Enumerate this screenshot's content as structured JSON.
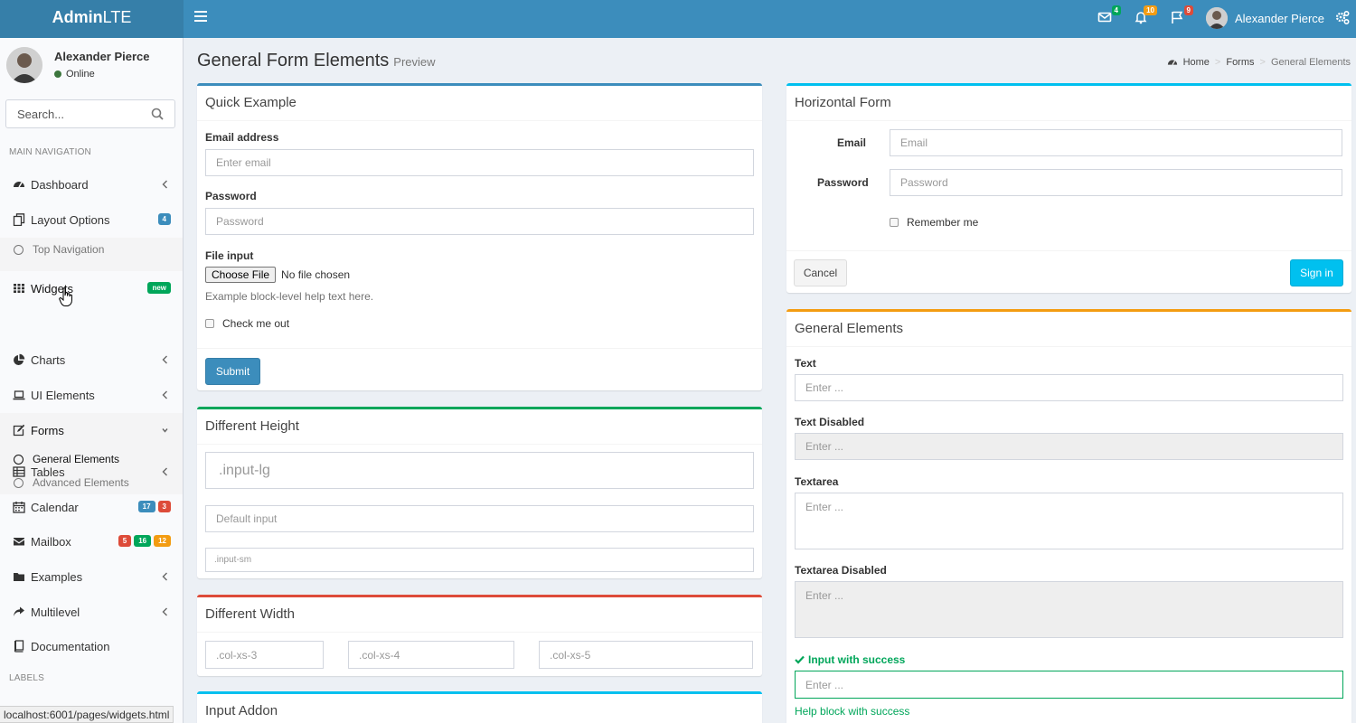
{
  "header": {
    "logo_bold": "Admin",
    "logo_rest": "LTE",
    "messages_count": "4",
    "notifications_count": "10",
    "tasks_count": "9",
    "user_name": "Alexander Pierce",
    "colors": {
      "brand": "#3c8dbc",
      "logo_bg": "#367fa9"
    }
  },
  "sidebar": {
    "user_name": "Alexander Pierce",
    "user_status": "Online",
    "search_placeholder": "Search...",
    "main_nav_header": "MAIN NAVIGATION",
    "labels_header": "LABELS",
    "items": [
      {
        "label": "Dashboard",
        "icon": "dashboard-icon"
      },
      {
        "label": "Layout Options",
        "icon": "files-icon",
        "badge": "4"
      },
      {
        "label": "Widgets",
        "icon": "th-icon",
        "badge": "new"
      },
      {
        "label": "Charts",
        "icon": "pie-chart-icon"
      },
      {
        "label": "UI Elements",
        "icon": "laptop-icon"
      },
      {
        "label": "Forms",
        "icon": "edit-icon"
      },
      {
        "label": "Tables",
        "icon": "table-icon"
      },
      {
        "label": "Calendar",
        "icon": "calendar-icon",
        "badges": [
          "17",
          "3"
        ]
      },
      {
        "label": "Mailbox",
        "icon": "envelope-icon",
        "badges": [
          "5",
          "16",
          "12"
        ]
      },
      {
        "label": "Examples",
        "icon": "folder-icon"
      },
      {
        "label": "Multilevel",
        "icon": "share-icon"
      },
      {
        "label": "Documentation",
        "icon": "book-icon"
      }
    ],
    "layout_sub": [
      "Top Navigation"
    ],
    "forms_sub": [
      "General Elements",
      "Advanced Elements"
    ],
    "status_url": "localhost:6001/pages/widgets.html"
  },
  "content": {
    "title": "General Form Elements",
    "subtitle": "Preview",
    "breadcrumb": [
      "Home",
      "Forms",
      "General Elements"
    ]
  },
  "quick_example": {
    "title": "Quick Example",
    "email_label": "Email address",
    "email_placeholder": "Enter email",
    "password_label": "Password",
    "password_placeholder": "Password",
    "file_label": "File input",
    "file_button": "Choose File",
    "file_status": "No file chosen",
    "help_text": "Example block-level help text here.",
    "check_label": "Check me out",
    "submit": "Submit"
  },
  "different_height": {
    "title": "Different Height",
    "lg_placeholder": ".input-lg",
    "default_placeholder": "Default input",
    "sm_placeholder": ".input-sm"
  },
  "different_width": {
    "title": "Different Width",
    "col3": ".col-xs-3",
    "col4": ".col-xs-4",
    "col5": ".col-xs-5"
  },
  "input_addon": {
    "title": "Input Addon"
  },
  "horizontal_form": {
    "title": "Horizontal Form",
    "email_label": "Email",
    "email_placeholder": "Email",
    "password_label": "Password",
    "password_placeholder": "Password",
    "remember": "Remember me",
    "cancel": "Cancel",
    "sign_in": "Sign in"
  },
  "general_elements": {
    "title": "General Elements",
    "text_label": "Text",
    "text_placeholder": "Enter ...",
    "text_disabled_label": "Text Disabled",
    "text_disabled_placeholder": "Enter ...",
    "textarea_label": "Textarea",
    "textarea_placeholder": "Enter ...",
    "textarea_disabled_label": "Textarea Disabled",
    "textarea_disabled_placeholder": "Enter ...",
    "success_label": "Input with success",
    "success_placeholder": "Enter ...",
    "success_help": "Help block with success"
  }
}
